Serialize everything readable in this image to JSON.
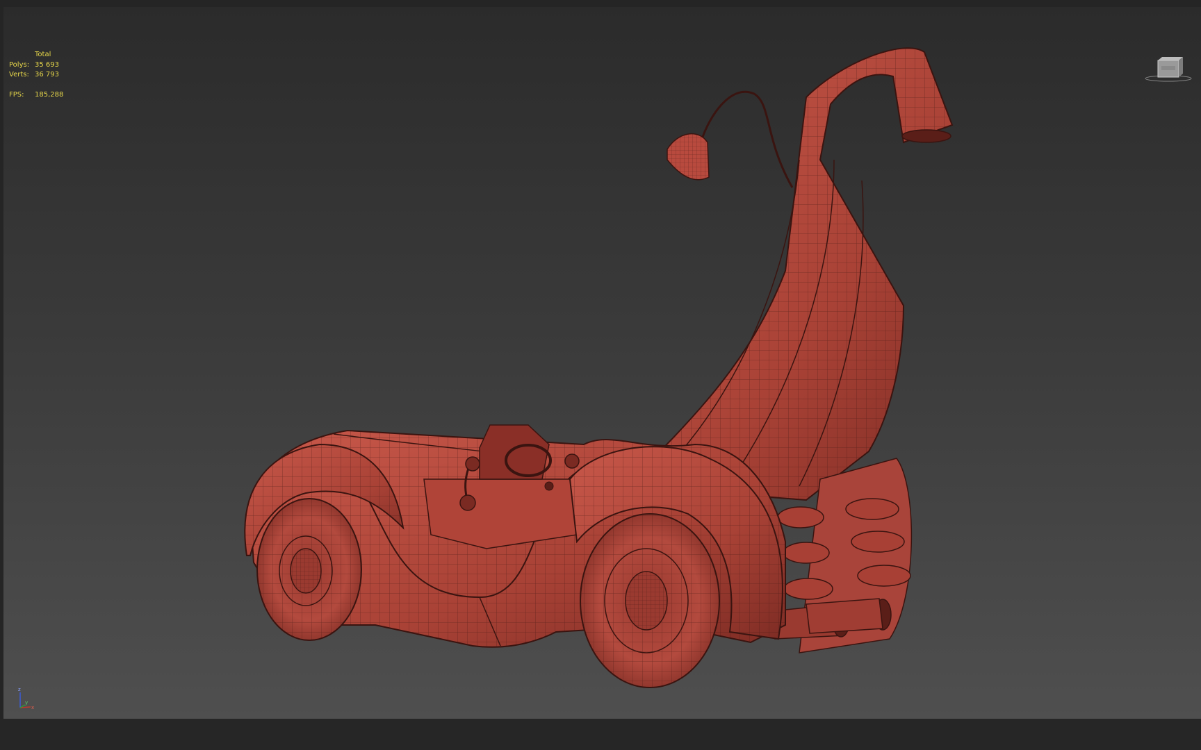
{
  "viewport": {
    "stats": {
      "header": "Total",
      "polys_label": "Polys:",
      "polys_value": "35 693",
      "verts_label": "Verts:",
      "verts_value": "36 793",
      "fps_label": "FPS:",
      "fps_value": "185,288"
    },
    "viewcube": {
      "icon": "viewcube-icon"
    },
    "axis_tripod": {
      "icon": "axis-tripod-icon",
      "z_label": "z",
      "x_label": "x",
      "y_label": "y"
    },
    "model": {
      "icon": "wireframe-car-model",
      "color": "#b84a3e"
    }
  },
  "colors": {
    "background": "#252525",
    "stats_text": "#e8d84a",
    "model_fill": "#b84a3e",
    "wire": "#3a1410"
  }
}
